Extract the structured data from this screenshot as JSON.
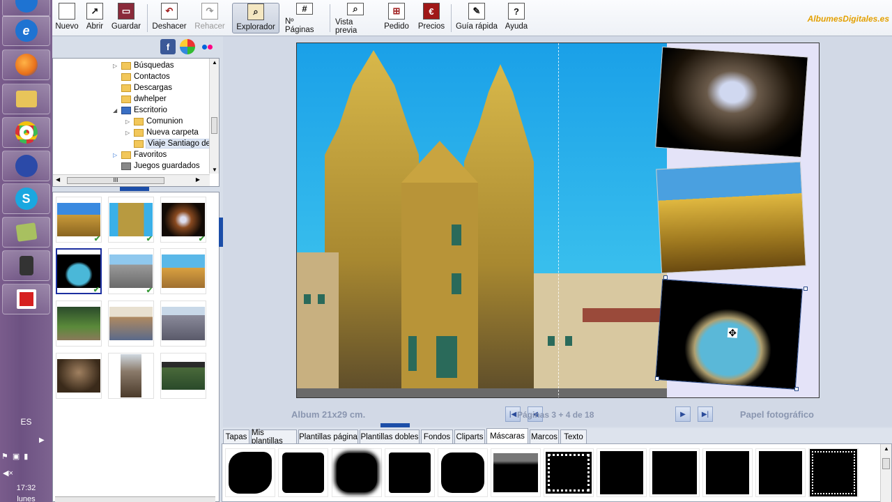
{
  "taskbar": {
    "apps": [
      {
        "name": "internet-explorer",
        "glyph": "e",
        "color": "#1e73d2"
      },
      {
        "name": "firefox",
        "glyph": "",
        "color": "#e8701a"
      },
      {
        "name": "file-explorer",
        "glyph": "",
        "color": "#e8c45a"
      },
      {
        "name": "chrome",
        "glyph": "",
        "color": "#3a8d3a"
      },
      {
        "name": "audio-app",
        "glyph": "",
        "color": "#2b4aa8"
      },
      {
        "name": "skype",
        "glyph": "S",
        "color": "#1aa7e0"
      },
      {
        "name": "notes",
        "glyph": "",
        "color": "#a8c060"
      },
      {
        "name": "camera",
        "glyph": "",
        "color": "#444444"
      },
      {
        "name": "albumes-app",
        "glyph": "",
        "color": "#d62020"
      }
    ],
    "language": "ES",
    "clock": "17:32",
    "day": "lunes"
  },
  "toolbar": {
    "nuevo": "Nuevo",
    "abrir": "Abrir",
    "guardar": "Guardar",
    "deshacer": "Deshacer",
    "rehacer": "Rehacer",
    "explorador": "Explorador",
    "npaginas": "Nº Páginas",
    "vista_previa": "Vista previa",
    "pedido": "Pedido",
    "precios": "Precios",
    "guia_rapida": "Guía rápida",
    "ayuda": "Ayuda",
    "brand": "AlbumesDigitales.es"
  },
  "tree": {
    "items": [
      {
        "label": "Búsquedas"
      },
      {
        "label": "Contactos"
      },
      {
        "label": "Descargas"
      },
      {
        "label": "dwhelper"
      },
      {
        "label": "Escritorio"
      },
      {
        "label": "Comunion"
      },
      {
        "label": "Nueva carpeta"
      },
      {
        "label": "Viaje Santiago de"
      },
      {
        "label": "Favoritos"
      },
      {
        "label": "Juegos guardados"
      }
    ],
    "scroll_glyph": "III"
  },
  "canvas": {
    "album": "Album 21x29 cm.",
    "pages": "Páginas 3 + 4 de 18",
    "paper": "Papel fotográfico"
  },
  "tabs": [
    {
      "label": "Tapas"
    },
    {
      "label": "Mis plantillas"
    },
    {
      "label": "Plantillas página"
    },
    {
      "label": "Plantillas dobles"
    },
    {
      "label": "Fondos"
    },
    {
      "label": "Cliparts"
    },
    {
      "label": "Máscaras"
    },
    {
      "label": "Marcos"
    },
    {
      "label": "Texto"
    }
  ],
  "social": {
    "facebook": "f",
    "picasa": "",
    "flickr": ""
  }
}
